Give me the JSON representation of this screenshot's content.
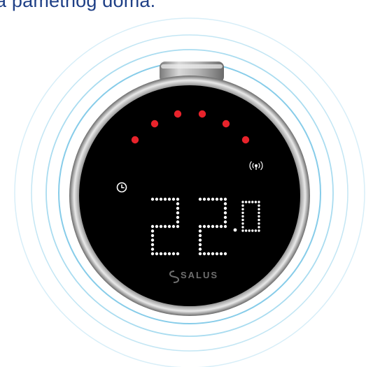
{
  "caption": "a pametnog doma.",
  "device": {
    "brand": "SALUS",
    "temperature": {
      "integer_digits": "22",
      "decimal_digit": "0"
    },
    "level_indicator": {
      "filled_dots": 6,
      "total_dots": 6
    },
    "icons": {
      "schedule": "clock-icon",
      "connectivity": "wireless-signal-icon",
      "brand_mark": "salus-logo-icon"
    },
    "colors": {
      "display_bg": "#000000",
      "dot_on": "#e8232b",
      "digit": "#ffffff",
      "ring": "#7fc8e6",
      "caption": "#1e3f86"
    }
  }
}
